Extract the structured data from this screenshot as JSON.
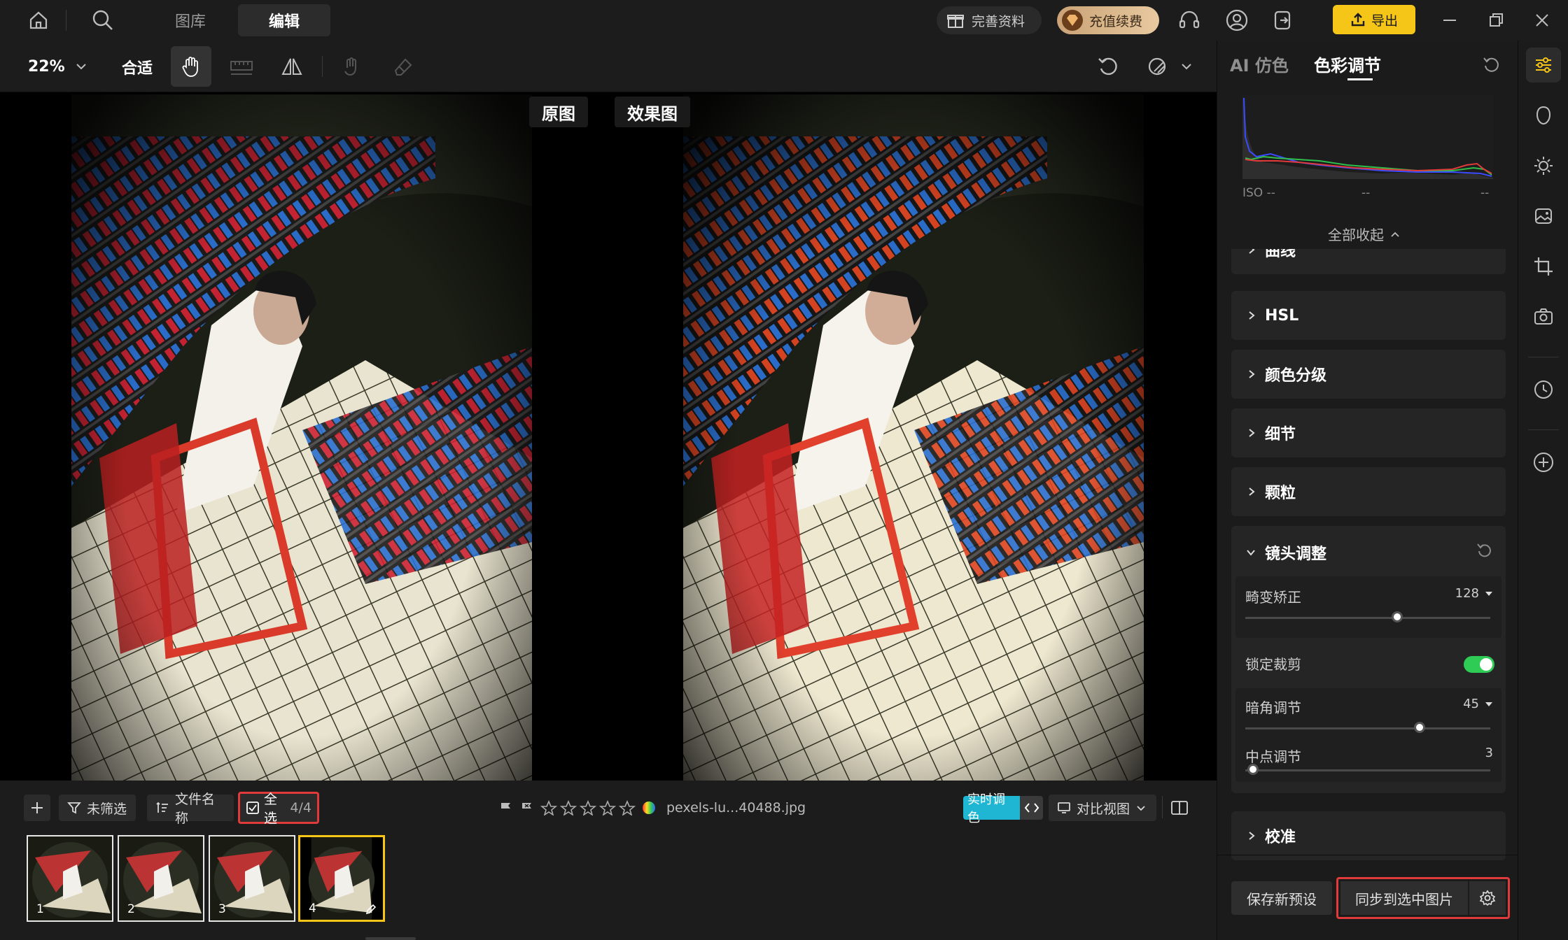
{
  "topbar": {
    "tabs": [
      "图库",
      "编辑"
    ],
    "active_tab": "编辑",
    "complete_profile": "完善资料",
    "recharge": "充值续费",
    "export": "导出"
  },
  "toolbar": {
    "zoom": "22%",
    "fit": "合适"
  },
  "canvas": {
    "original_label": "原图",
    "result_label": "效果图"
  },
  "bottombar": {
    "filter": "未筛选",
    "sort": "文件名称",
    "select_all": "全选",
    "select_count": "4/4",
    "filename": "pexels-lu...40488.jpg",
    "realtime": "实时调色",
    "compare_view": "对比视图",
    "thumbnails": [
      {
        "num": "1"
      },
      {
        "num": "2"
      },
      {
        "num": "3"
      },
      {
        "num": "4"
      }
    ]
  },
  "panel": {
    "tabs": [
      "AI 仿色",
      "色彩调节"
    ],
    "active_tab": "色彩调节",
    "histogram": {
      "iso": "ISO --",
      "mid": "--",
      "right": "--"
    },
    "collapse_all": "全部收起",
    "sections": {
      "curves": "曲线",
      "hsl": "HSL",
      "grading": "颜色分级",
      "detail": "细节",
      "grain": "颗粒",
      "lens": "镜头调整",
      "calibration": "校准"
    },
    "lens": {
      "distortion_label": "畸变矫正",
      "distortion_value": "128",
      "distortion_level": 0.62,
      "lock_crop_label": "锁定裁剪",
      "lock_crop_on": true,
      "vignette_label": "暗角调节",
      "vignette_value": "45",
      "vignette_level": 0.71,
      "midpoint_label": "中点调节",
      "midpoint_value": "3",
      "midpoint_level": 0.03
    },
    "save_preset": "保存新预设",
    "sync": "同步到选中图片"
  },
  "colors": {
    "accent_yellow": "#f5c518",
    "toggle_green": "#2ecc55",
    "highlight_red": "#e03a3a",
    "realtime_cyan": "#1fb6d4"
  }
}
